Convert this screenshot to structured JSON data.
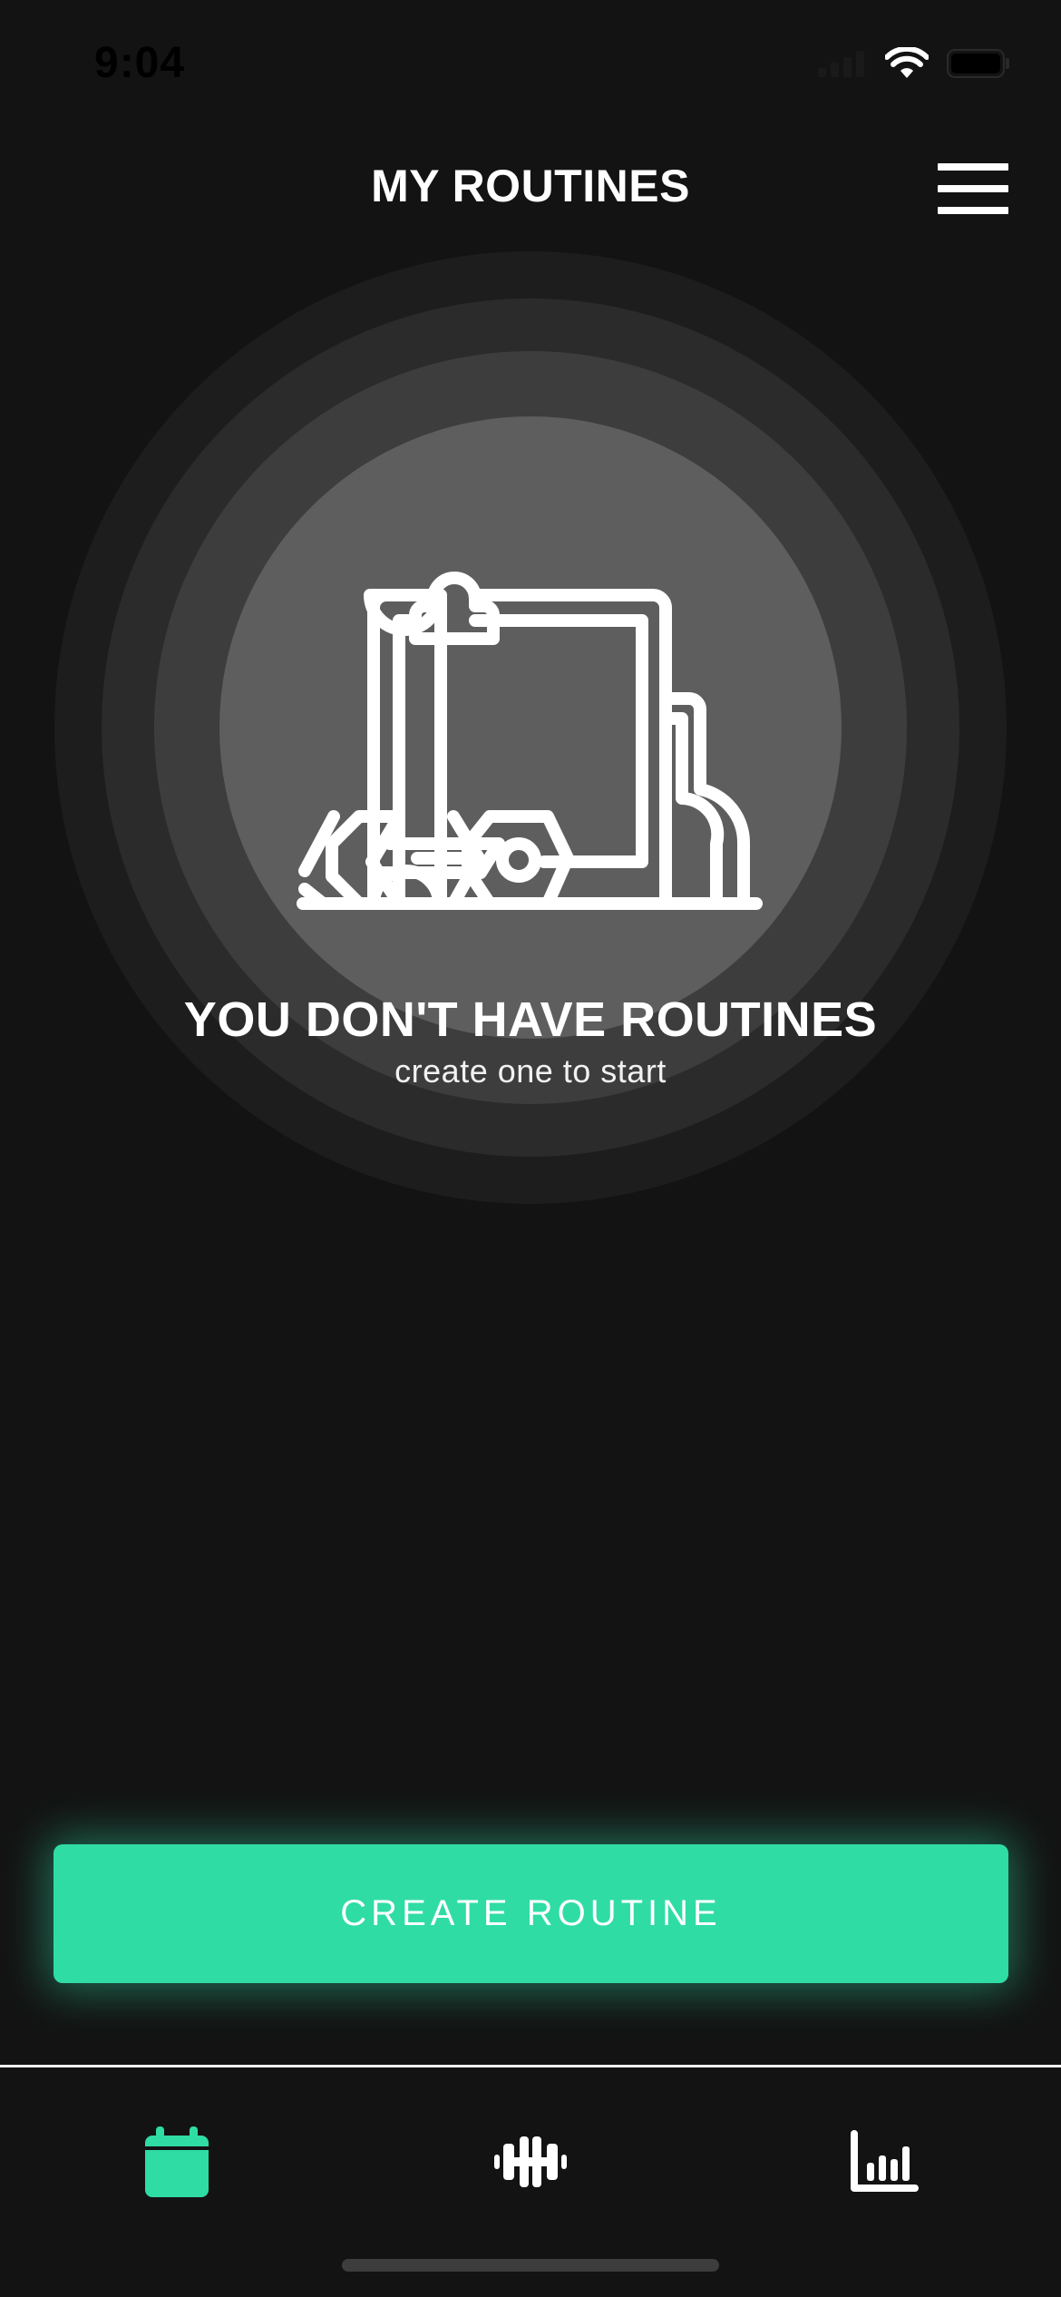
{
  "status_bar": {
    "time": "9:04"
  },
  "header": {
    "title": "MY ROUTINES",
    "menu_icon": "hamburger-menu-icon"
  },
  "empty_state": {
    "illustration": "clipboard-dumbbell-illustration",
    "title": "YOU DON'T HAVE ROUTINES",
    "subtitle": "create one to start"
  },
  "cta": {
    "label": "CREATE ROUTINE"
  },
  "tabs": [
    {
      "id": "routines",
      "icon": "calendar-icon",
      "active": true
    },
    {
      "id": "exercises",
      "icon": "dumbbell-icon",
      "active": false
    },
    {
      "id": "stats",
      "icon": "bar-chart-icon",
      "active": false
    }
  ],
  "colors": {
    "background": "#131313",
    "accent": "#2fdca4",
    "text": "#ffffff"
  }
}
